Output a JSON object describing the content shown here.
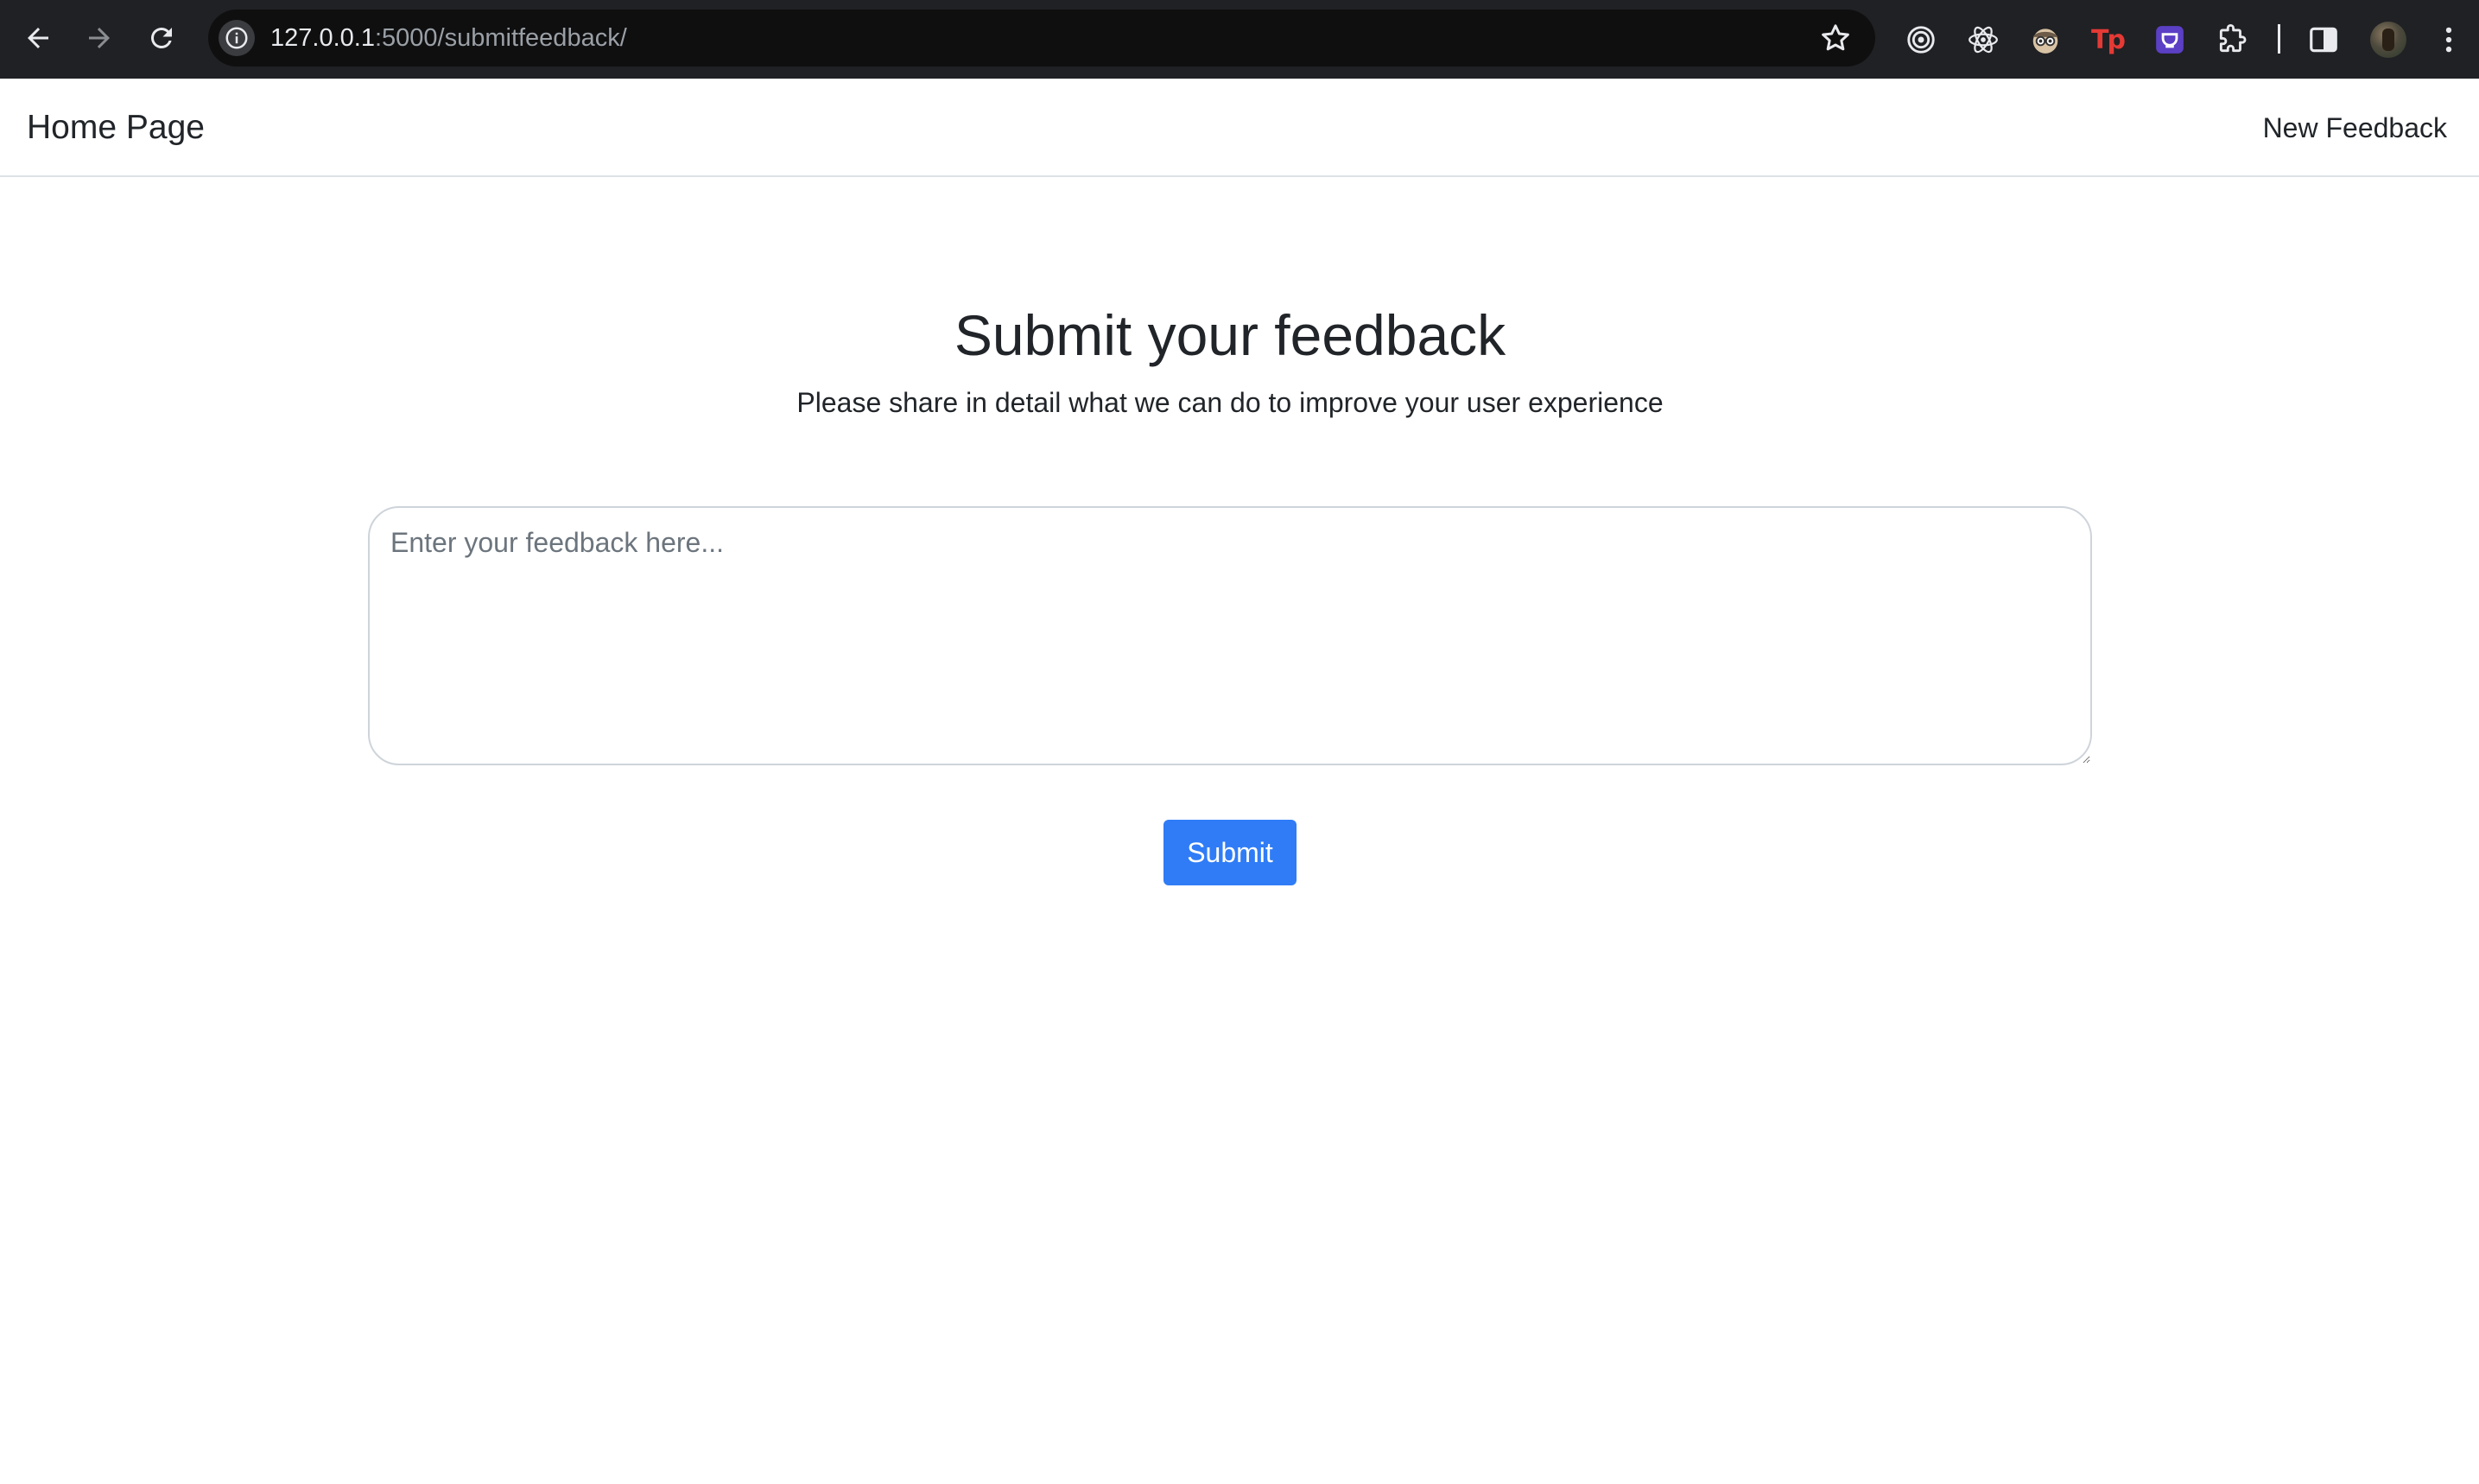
{
  "browser": {
    "url_host": "127.0.0.1",
    "url_path": ":5000/submitfeedback/",
    "icons": {
      "back": "arrow-left-icon",
      "forward": "arrow-right-icon",
      "reload": "reload-icon",
      "site_info": "info-icon",
      "bookmark": "star-icon"
    },
    "extensions": [
      {
        "name": "target-extension-icon"
      },
      {
        "name": "react-devtools-icon"
      },
      {
        "name": "spy-face-extension-icon"
      },
      {
        "name": "tp-extension-icon",
        "glyph": "Tp"
      },
      {
        "name": "purple-extension-icon"
      },
      {
        "name": "puzzle-extensions-icon"
      }
    ]
  },
  "navbar": {
    "brand": "Home Page",
    "link": "New Feedback"
  },
  "main": {
    "heading": "Submit your feedback",
    "subheading": "Please share in detail what we can do to improve your user experience",
    "feedback_placeholder": "Enter your feedback here...",
    "feedback_value": "",
    "submit_label": "Submit"
  },
  "colors": {
    "chrome_bg": "#202124",
    "omnibox_bg": "#0f0f10",
    "primary": "#2f7cf6",
    "text": "#212529",
    "placeholder": "#6c757d",
    "border": "#ced4da"
  }
}
